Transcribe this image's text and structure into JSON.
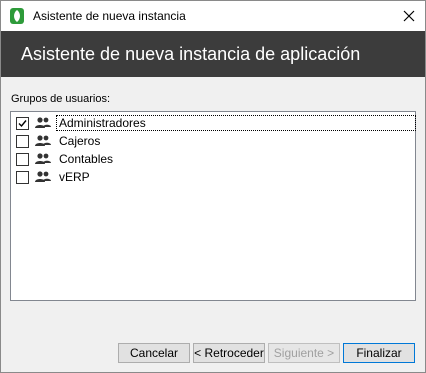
{
  "window": {
    "title": "Asistente de nueva instancia",
    "app_icon": "shield-leaf-icon",
    "close_icon": "close-icon"
  },
  "header": {
    "title": "Asistente de nueva instancia de aplicación"
  },
  "groups": {
    "label": "Grupos de usuarios:",
    "items": [
      {
        "label": "Administradores",
        "checked": true,
        "selected": true
      },
      {
        "label": "Cajeros",
        "checked": false,
        "selected": false
      },
      {
        "label": "Contables",
        "checked": false,
        "selected": false
      },
      {
        "label": "vERP",
        "checked": false,
        "selected": false
      }
    ]
  },
  "buttons": {
    "cancel": "Cancelar",
    "back": "< Retroceder",
    "next": "Siguiente >",
    "finish": "Finalizar"
  },
  "colors": {
    "header_bg": "#3c3c3c",
    "accent_border": "#0078d7",
    "icon_green": "#2e9b3a"
  }
}
